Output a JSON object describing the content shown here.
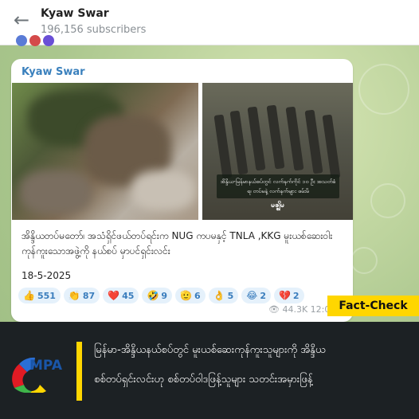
{
  "header": {
    "back_icon": "arrow-left-icon",
    "title": "Kyaw Swar",
    "subscribers": "196,156 subscribers"
  },
  "post": {
    "author": "Kyaw Swar",
    "overlay_text": "အိန္ဒိယ-မြန်မာနယ်စပ်တွင် လက်နက်ကိုင် ၁၀ ဦး အသတ်ခံရ၊ တပ်မနဲ့ လက်နက်များ ဖမ်းမိ",
    "overlay_logo": "မဇ္ဈိမ",
    "caption": "အိန္ဒိယတပ်မတော်၊ အသံရှိင်ဖယ်တပ်ရင်းက NUG ကပမနှင့် TNLA ,KKG မူးယစ်ဆေးဝါး ကုန်ကူးသောအဖွဲ့ကို နယ်စပ် မှာပင်ရှင်းလင်း",
    "date": "18-5-2025",
    "views": "44.3K 12:0",
    "reactions": [
      {
        "emoji": "👍",
        "count": "551"
      },
      {
        "emoji": "👏",
        "count": "87"
      },
      {
        "emoji": "❤️",
        "count": "45"
      },
      {
        "emoji": "🤣",
        "count": "9"
      },
      {
        "emoji": "🫡",
        "count": "6"
      },
      {
        "emoji": "👌",
        "count": "5"
      },
      {
        "emoji": "😂",
        "count": "2"
      },
      {
        "emoji": "💔",
        "count": "2"
      }
    ]
  },
  "badge": {
    "label": "Fact-Check",
    "color": "#ffd600"
  },
  "banner": {
    "logo_text": "MPA",
    "headline_line1": "မြန်မာ-အိန္ဒိယနယ်စပ်တွင် မူးယစ်ဆေးကုန်ကူးသူများကို အိန္ဒိယ",
    "headline_line2": "စစ်တပ်ရှင်းလင်းဟု စစ်တပ်ဝါဒဖြန့်သူများ သတင်းအမှားဖြန့်"
  }
}
